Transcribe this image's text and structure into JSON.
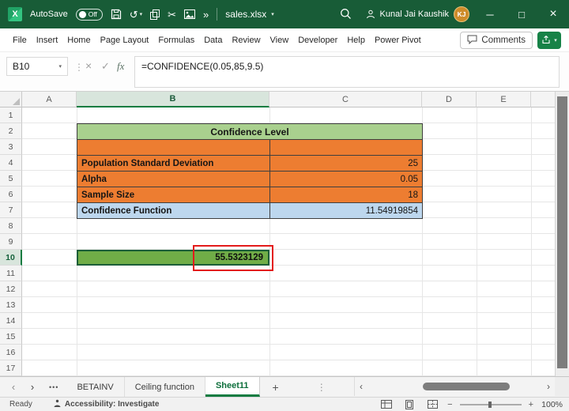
{
  "title_bar": {
    "app_initial": "X",
    "autosave_label": "AutoSave",
    "autosave_state": "Off",
    "file_name": "sales.xlsx",
    "user_name": "Kunal Jai Kaushik",
    "avatar_initials": "KJ"
  },
  "ribbon": {
    "tabs": [
      "File",
      "Insert",
      "Home",
      "Page Layout",
      "Formulas",
      "Data",
      "Review",
      "View",
      "Developer",
      "Help",
      "Power Pivot"
    ],
    "comments_label": "Comments"
  },
  "formula_bar": {
    "name_box_value": "B10",
    "fx_label": "fx",
    "formula": "=CONFIDENCE(0.05,85,9.5)"
  },
  "grid": {
    "column_headers": [
      "A",
      "B",
      "C",
      "D",
      "E"
    ],
    "row_headers": [
      "1",
      "2",
      "3",
      "4",
      "5",
      "6",
      "7",
      "8",
      "9",
      "10",
      "11",
      "12",
      "13",
      "14",
      "15",
      "16",
      "17"
    ]
  },
  "sheet": {
    "table_title": "Confidence Level",
    "rows": [
      {
        "label": "Population Standard Deviation",
        "value": "25"
      },
      {
        "label": "Alpha",
        "value": "0.05"
      },
      {
        "label": "Sample Size",
        "value": "18"
      },
      {
        "label": "Confidence Function",
        "value": "11.54919854"
      }
    ],
    "result_value": "55.5323129"
  },
  "tab_bar": {
    "tabs": [
      "BETAINV",
      "Ceiling function",
      "Sheet11"
    ],
    "active_tab": "Sheet11"
  },
  "status_bar": {
    "mode": "Ready",
    "accessibility": "Accessibility: Investigate",
    "zoom": "100%"
  },
  "icons": {
    "undo": "↺",
    "cut": "✂",
    "overflow": "»",
    "chevron_down": "▾",
    "vertical_dots": "⋮",
    "cancel": "×",
    "enter": "✓",
    "minimize": "─",
    "maximize": "□",
    "close": "×",
    "chevron_left": "‹",
    "chevron_right": "›",
    "more_tabs": "•••",
    "add_sheet": "+",
    "zoom_out": "−",
    "zoom_in": "+"
  },
  "colors": {
    "title_bar_green": "#185C37",
    "accent_green": "#107C41",
    "table_header_fill": "#A9D08E",
    "orange_fill": "#ED7D31",
    "blue_fill": "#BDD7EE",
    "result_fill": "#70AD47",
    "annotation_red": "#E31B1B",
    "avatar_fill": "#CE8C2A"
  }
}
